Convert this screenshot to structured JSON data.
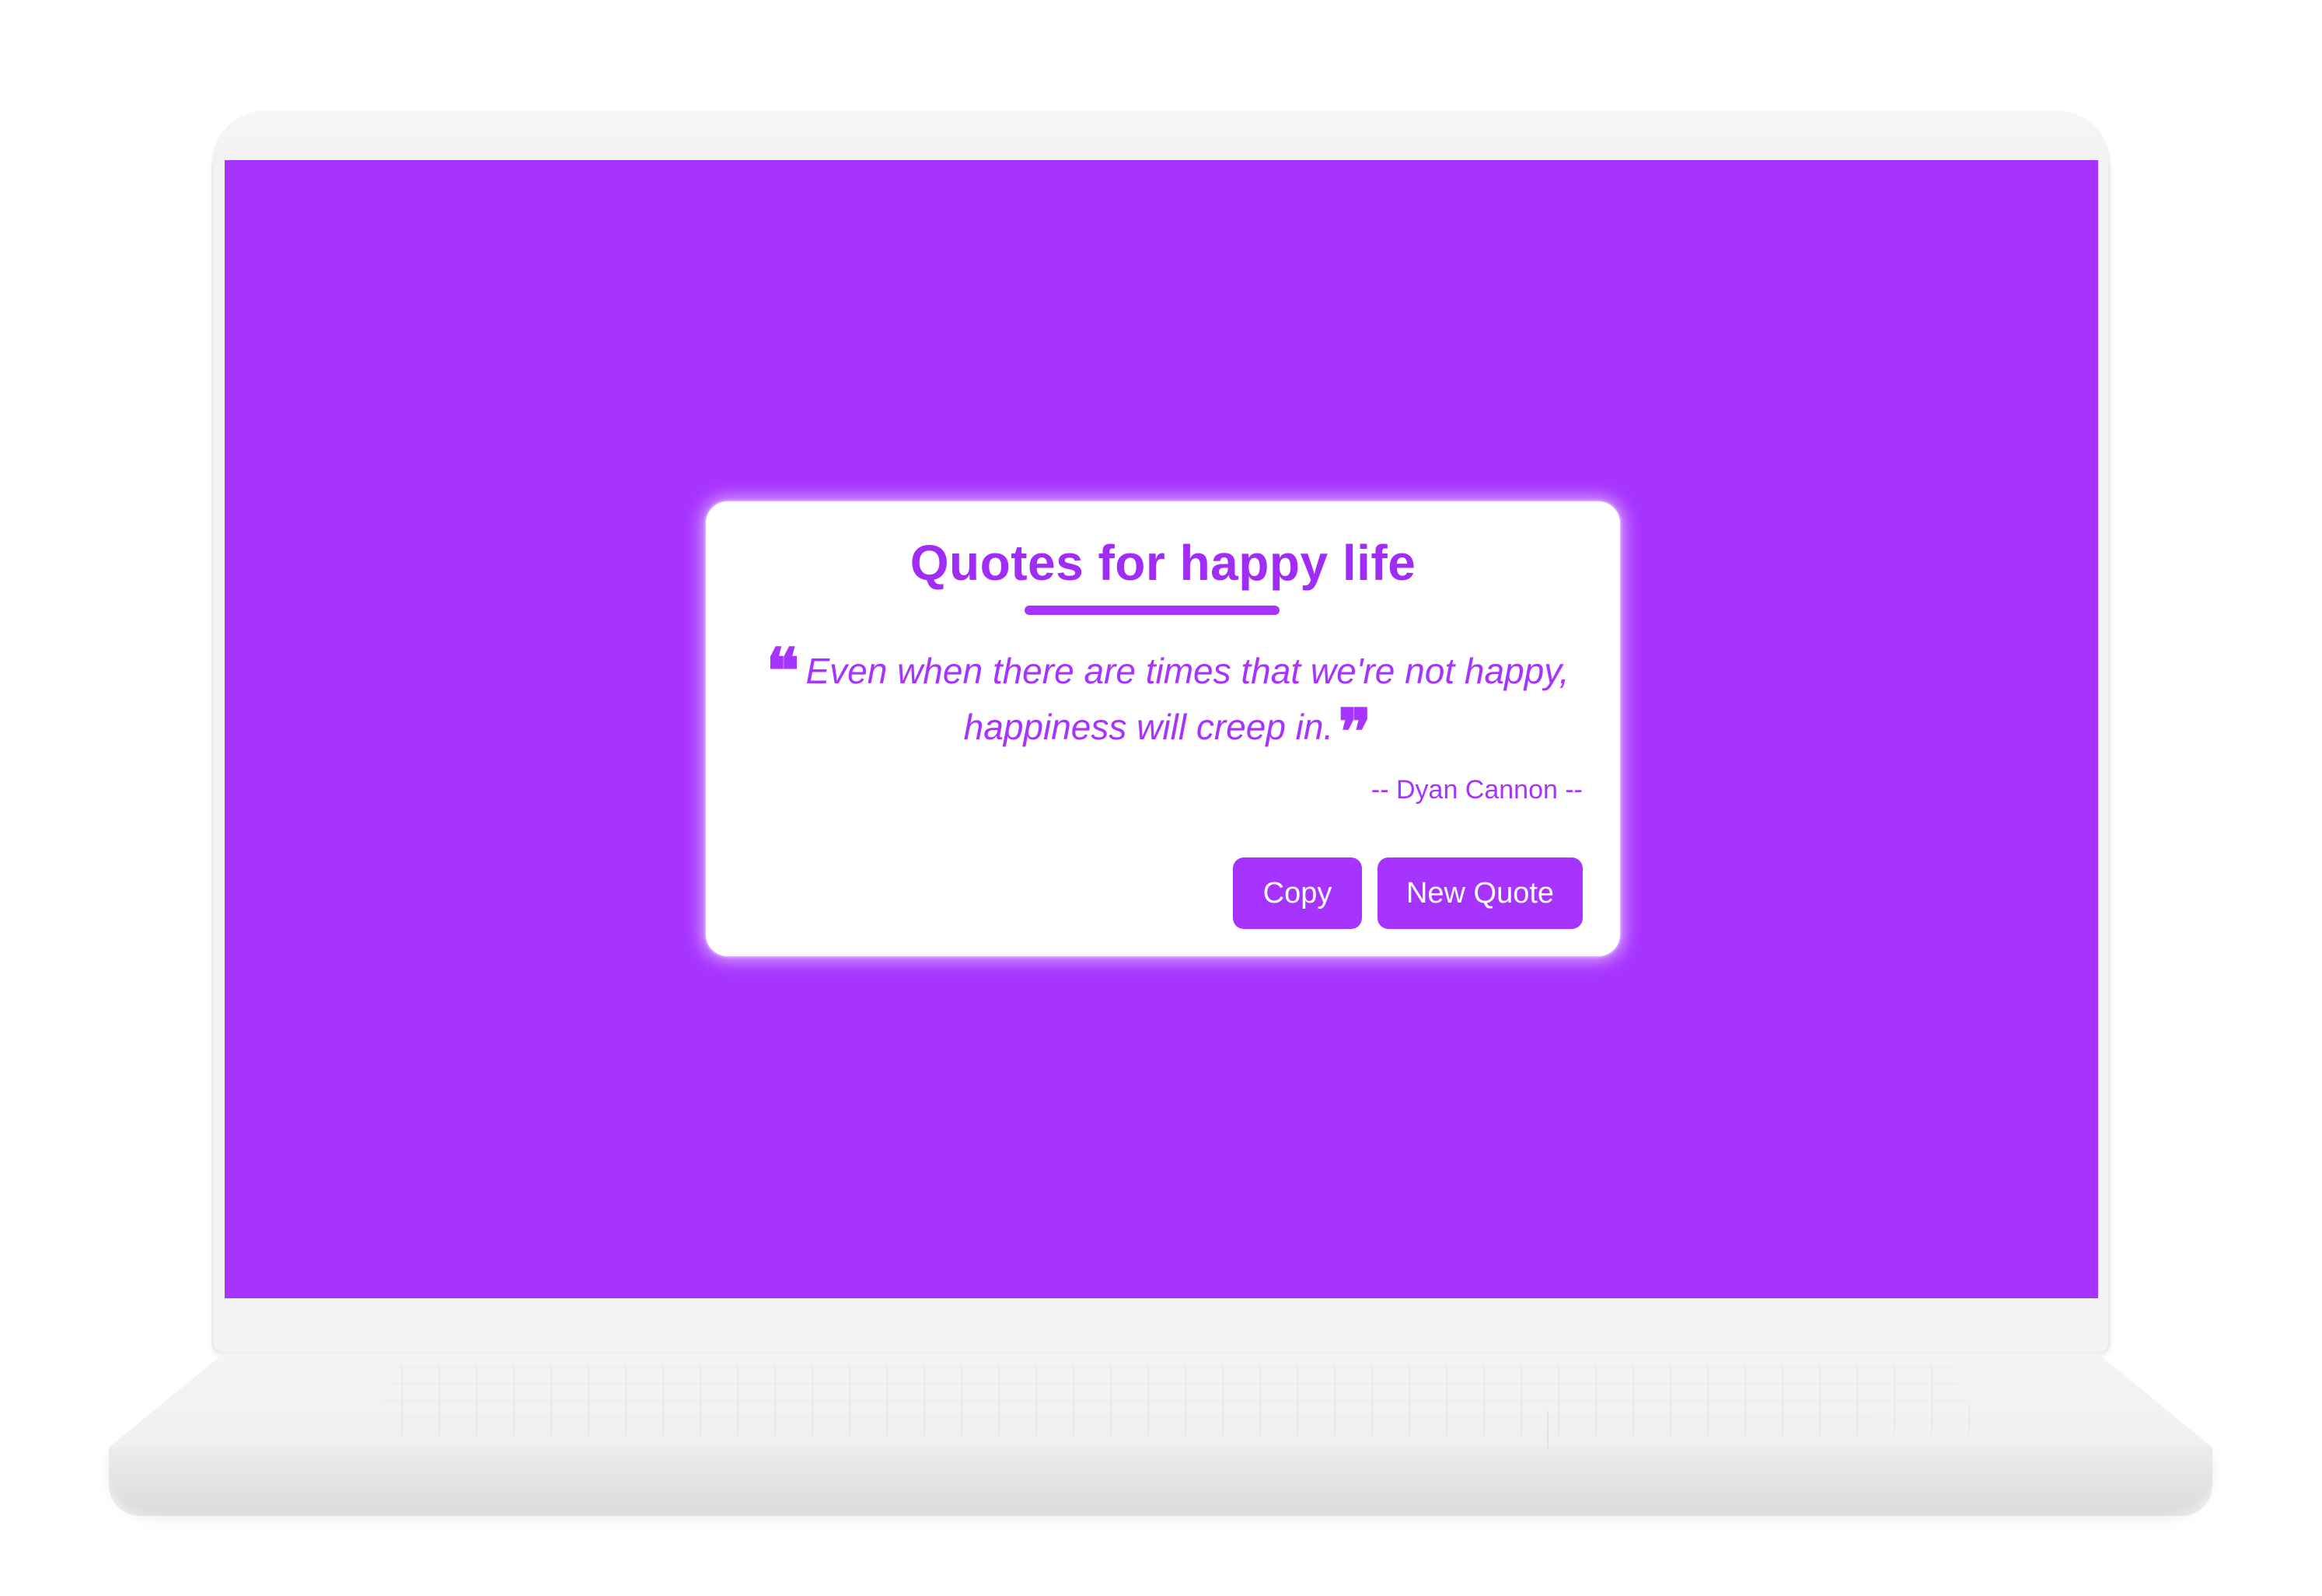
{
  "card": {
    "title": "Quotes for happy life",
    "quote_open_mark": "❝",
    "quote_text": "Even when there are times that we're not happy, happiness will creep in.",
    "quote_close_mark": "❞",
    "author": "-- Dyan Cannon --",
    "copy_label": "Copy",
    "new_quote_label": "New Quote"
  },
  "colors": {
    "accent": "#a733ff",
    "card_background": "#ffffff",
    "laptop_body": "#f3f3f5"
  }
}
